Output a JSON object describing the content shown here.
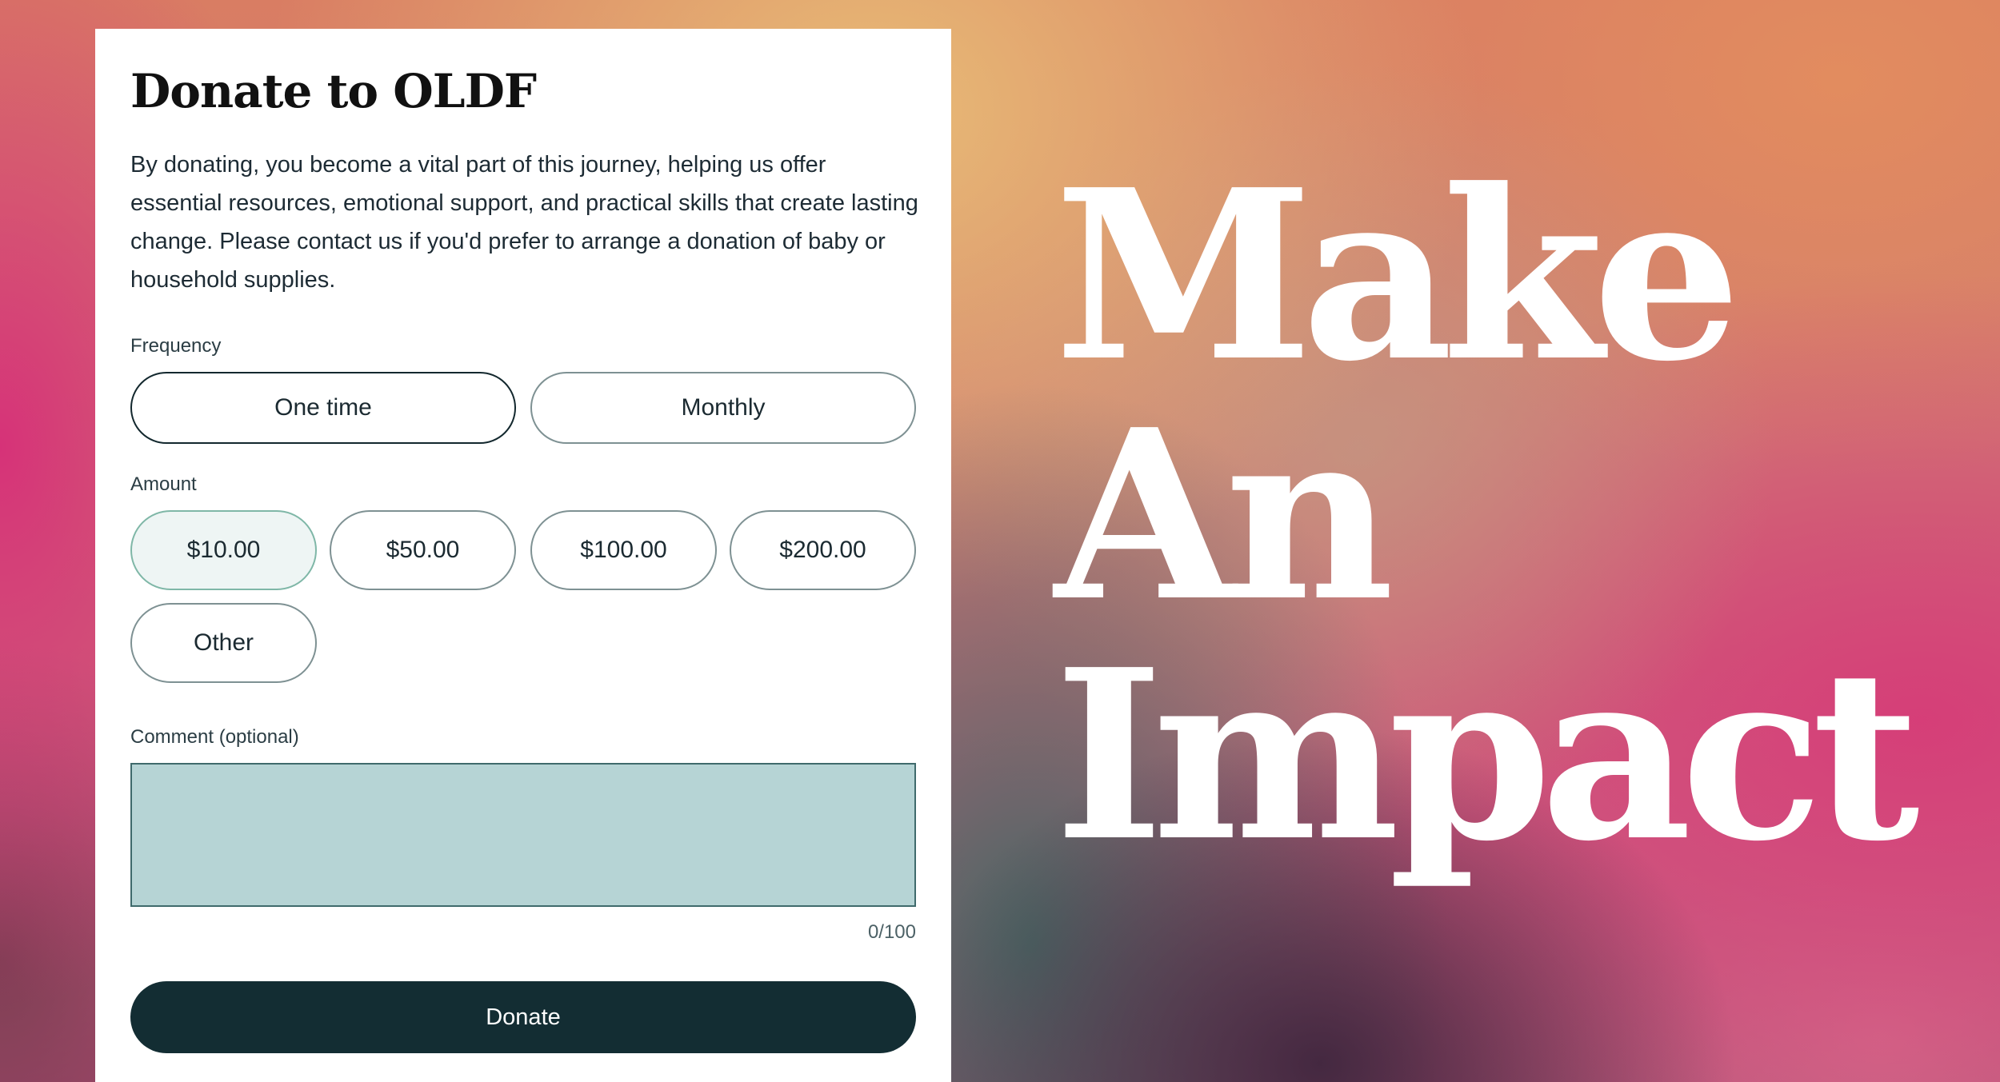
{
  "form": {
    "title": "Donate to OLDF",
    "description": "By donating, you become a vital part of this journey, helping us offer essential resources, emotional support, and practical skills that create lasting change. Please contact us if you'd prefer to arrange a donation of baby or household supplies.",
    "frequency": {
      "label": "Frequency",
      "options": [
        "One time",
        "Monthly"
      ],
      "selected": "One time"
    },
    "amount": {
      "label": "Amount",
      "options": [
        "$10.00",
        "$50.00",
        "$100.00",
        "$200.00",
        "Other"
      ],
      "selected": "$10.00"
    },
    "comment": {
      "label": "Comment (optional)",
      "value": "",
      "counter": "0/100"
    },
    "donate_label": "Donate"
  },
  "hero": {
    "lines": [
      "Make",
      "An",
      "Impact"
    ]
  },
  "colors": {
    "button_dark": "#132d33",
    "comment_bg": "#b6d4d5",
    "selected_amount_bg": "#eef5f4"
  }
}
